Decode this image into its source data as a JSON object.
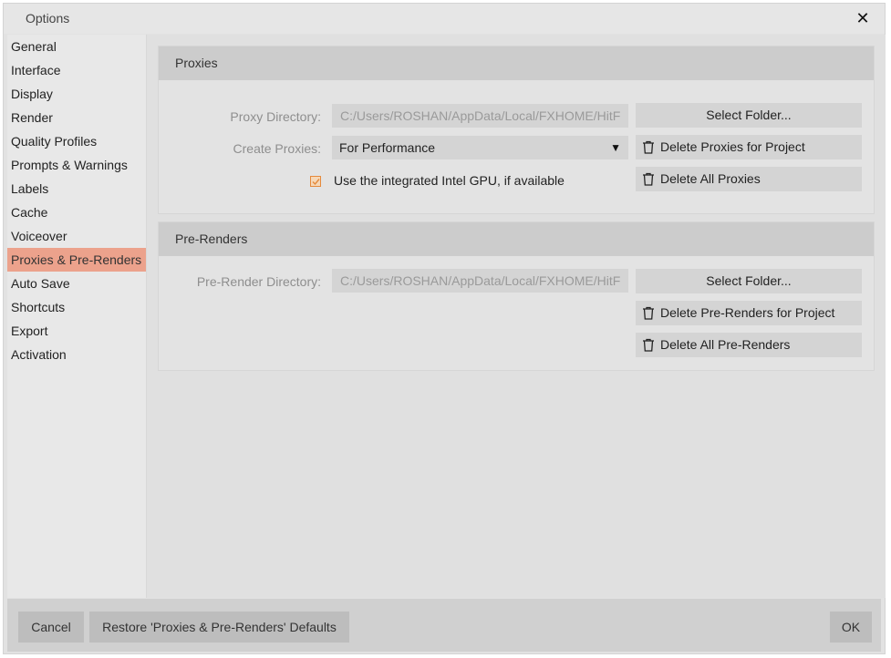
{
  "window": {
    "title": "Options",
    "close_glyph": "✕"
  },
  "sidebar": {
    "items": [
      {
        "label": "General"
      },
      {
        "label": "Interface"
      },
      {
        "label": "Display"
      },
      {
        "label": "Render"
      },
      {
        "label": "Quality Profiles"
      },
      {
        "label": "Prompts & Warnings"
      },
      {
        "label": "Labels"
      },
      {
        "label": "Cache"
      },
      {
        "label": "Voiceover"
      },
      {
        "label": "Proxies & Pre-Renders",
        "active": true
      },
      {
        "label": "Auto Save"
      },
      {
        "label": "Shortcuts"
      },
      {
        "label": "Export"
      },
      {
        "label": "Activation"
      }
    ]
  },
  "proxies": {
    "header": "Proxies",
    "directory_label": "Proxy Directory:",
    "directory_value": "C:/Users/ROSHAN/AppData/Local/FXHOME/HitF",
    "create_label": "Create Proxies:",
    "create_value": "For Performance",
    "gpu_checkbox_label": "Use the integrated Intel GPU, if available",
    "gpu_checked": true,
    "select_folder": "Select Folder...",
    "delete_project": "Delete Proxies for Project",
    "delete_all": "Delete All Proxies"
  },
  "prerenders": {
    "header": "Pre-Renders",
    "directory_label": "Pre-Render Directory:",
    "directory_value": "C:/Users/ROSHAN/AppData/Local/FXHOME/HitF",
    "select_folder": "Select Folder...",
    "delete_project": "Delete Pre-Renders for Project",
    "delete_all": "Delete All Pre-Renders"
  },
  "footer": {
    "cancel": "Cancel",
    "restore": "Restore 'Proxies & Pre-Renders' Defaults",
    "ok": "OK"
  },
  "colors": {
    "active_item": "#eca28c",
    "checkbox_accent": "#e58a3c"
  }
}
